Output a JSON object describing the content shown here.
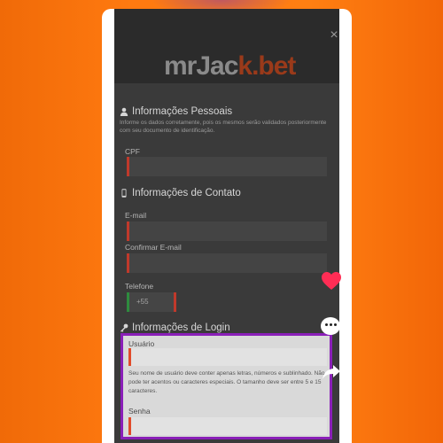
{
  "modal": {
    "close_glyph": "×",
    "logo": {
      "part_white": "mrJac",
      "part_red": "k.bet"
    }
  },
  "personal": {
    "title": "Informações Pessoais",
    "icon": "user-icon",
    "description": "Informe os dados corretamente, pois os mesmos serão validados posteriormente com seu documento de identificação.",
    "cpf_label": "CPF"
  },
  "contact": {
    "title": "Informações de Contato",
    "icon": "mobile-phone-icon",
    "email_label": "E-mail",
    "confirm_email_label": "Confirmar E-mail",
    "phone_label": "Telefone",
    "phone_prefix": "+55"
  },
  "login": {
    "title": "Informações de Login",
    "icon": "key-icon",
    "username_label": "Usuário",
    "username_help": "Seu nome de usuário deve conter apenas letras, números e sublinhado. Não pode ter acentos ou caracteres especiais. O tamanho deve ser entre 5 e 15 caracteres.",
    "password_label": "Senha"
  },
  "overlay_icons": {
    "like": "heart-icon",
    "comment": "chat-bubble-icon",
    "share": "share-arrow-icon"
  },
  "colors": {
    "highlight_border": "#8a1fb8",
    "accent_red": "#c0392b",
    "heart": "#ff2d55",
    "background_orange": "#ff7a10"
  }
}
